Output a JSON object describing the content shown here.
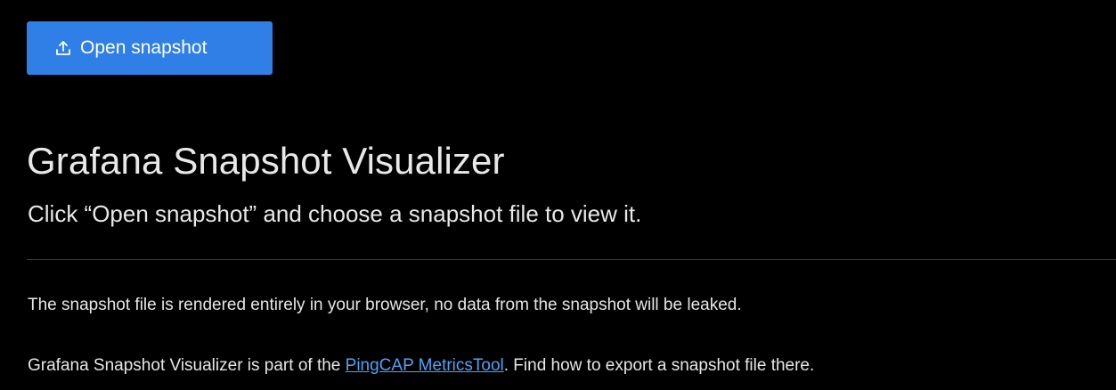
{
  "toolbar": {
    "open_button_label": "Open snapshot",
    "open_button_icon": "upload-icon"
  },
  "header": {
    "title": "Grafana Snapshot Visualizer",
    "subtitle": "Click “Open snapshot” and choose a snapshot file to view it."
  },
  "body": {
    "privacy_text": "The snapshot file is rendered entirely in your browser, no data from the snapshot will be leaked.",
    "info_prefix": "Grafana Snapshot Visualizer is part of the ",
    "info_link": "PingCAP MetricsTool",
    "info_suffix": ". Find how to export a snapshot file there."
  },
  "colors": {
    "background": "#000000",
    "button": "#2f7fe6",
    "link": "#4fa3f7",
    "text": "#e6e6e6"
  }
}
